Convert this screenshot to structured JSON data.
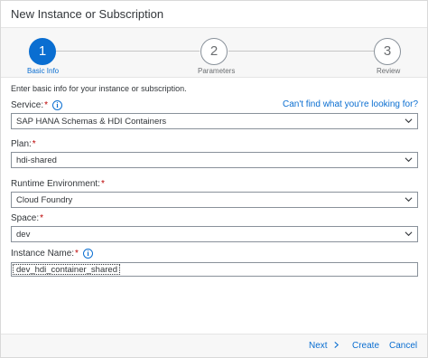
{
  "dialog": {
    "title": "New Instance or Subscription"
  },
  "wizard": {
    "steps": [
      {
        "number": "1",
        "label": "Basic Info"
      },
      {
        "number": "2",
        "label": "Parameters"
      },
      {
        "number": "3",
        "label": "Review"
      }
    ]
  },
  "form": {
    "intro": "Enter basic info for your instance or subscription.",
    "help_link": "Can't find what you're looking for?",
    "service": {
      "label": "Service:",
      "value": "SAP HANA Schemas & HDI Containers"
    },
    "plan": {
      "label": "Plan:",
      "value": "hdi-shared"
    },
    "runtime": {
      "label": "Runtime Environment:",
      "value": "Cloud Foundry"
    },
    "space": {
      "label": "Space:",
      "value": "dev"
    },
    "instance_name": {
      "label": "Instance Name:",
      "value": "dev_hdi_container_shared"
    },
    "required_marker": "*",
    "info_glyph": "i"
  },
  "footer": {
    "next": "Next",
    "create": "Create",
    "cancel": "Cancel"
  },
  "colors": {
    "accent": "#0a6ed1",
    "required": "#bb0000"
  }
}
